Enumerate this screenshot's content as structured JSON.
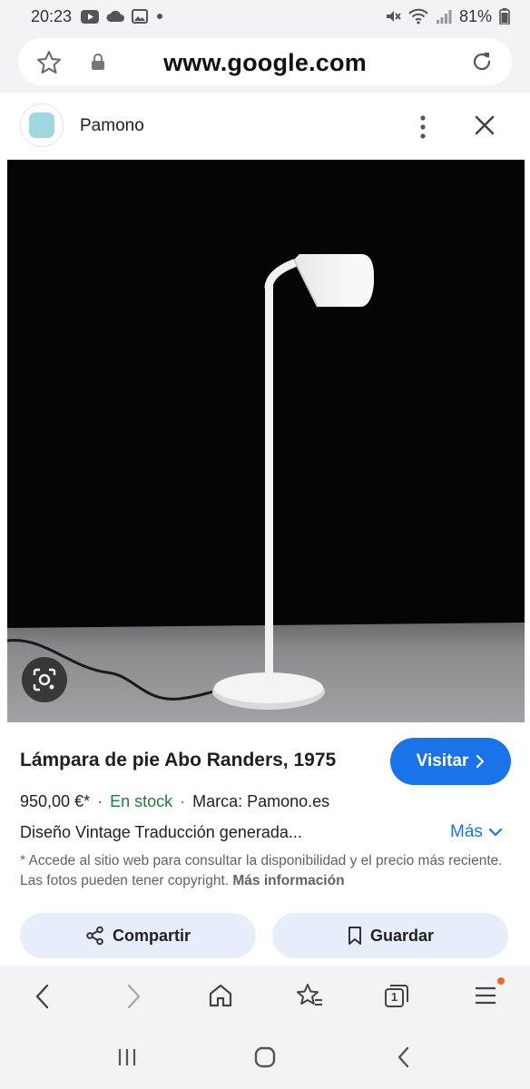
{
  "status_bar": {
    "time": "20:23",
    "battery": "81%",
    "icons": [
      "youtube-icon",
      "cloud-icon",
      "image-icon",
      "dot-icon",
      "mute-icon",
      "wifi-icon",
      "signal-icon",
      "battery-icon"
    ]
  },
  "url_bar": {
    "url": "www.google.com",
    "icons": [
      "star-icon",
      "lock-icon",
      "reload-icon"
    ]
  },
  "site_header": {
    "site_name": "Pamono",
    "icons": [
      "site-favicon",
      "more-vert-icon",
      "close-icon"
    ]
  },
  "product": {
    "title": "Lámpara de pie Abo Randers, 1975",
    "visit_label": "Visitar",
    "price": "950,00 €*",
    "separator": "·",
    "stock": "En stock",
    "brand": "Marca: Pamono.es",
    "description": "Diseño Vintage Traducción generada...",
    "more_label": "Más",
    "note": "* Accede al sitio web para consultar la disponibilidad y el precio más reciente. Las fotos pueden tener copyright.",
    "more_info_label": "Más información",
    "share_label": "Compartir",
    "save_label": "Guardar"
  },
  "toolbar": {
    "icons": [
      "back-icon",
      "forward-icon",
      "home-icon",
      "bookmark-star-icon",
      "tabs-icon",
      "menu-icon"
    ],
    "tabs_count": "1"
  },
  "system_nav": {
    "icons": [
      "recents-icon",
      "home-button-icon",
      "back-nav-icon"
    ]
  },
  "colors": {
    "accent": "#1a73e8",
    "stock_green": "#188038",
    "pill_bg": "#e8eef9",
    "chrome_bg": "#f2f3f5",
    "notification_dot": "#f26522"
  }
}
